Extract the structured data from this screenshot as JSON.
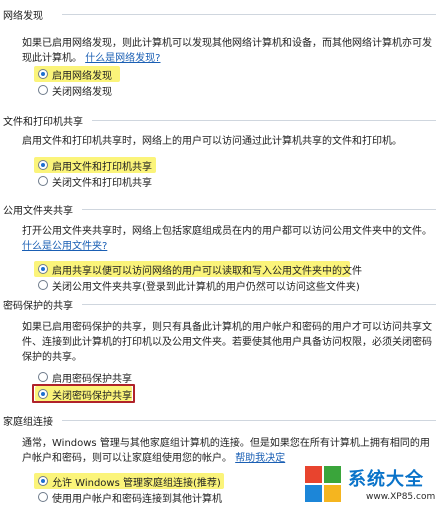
{
  "sections": [
    {
      "title": "网络发现",
      "desc": "如果已启用网络发现，则此计算机可以发现其他网络计算机和设备，而其他网络计算机亦可发现此计算机。",
      "link": "什么是网络发现?",
      "options": [
        {
          "label": "启用网络发现",
          "selected": true
        },
        {
          "label": "关闭网络发现",
          "selected": false
        }
      ]
    },
    {
      "title": "文件和打印机共享",
      "desc": "启用文件和打印机共享时，网络上的用户可以访问通过此计算机共享的文件和打印机。",
      "options": [
        {
          "label": "启用文件和打印机共享",
          "selected": true
        },
        {
          "label": "关闭文件和打印机共享",
          "selected": false
        }
      ]
    },
    {
      "title": "公用文件夹共享",
      "desc": "打开公用文件夹共享时，网络上包括家庭组成员在内的用户都可以访问公用文件夹中的文件。",
      "link_tail": "什么",
      "link_cont": "是公用文件夹?",
      "options": [
        {
          "label": "启用共享以便可以访问网络的用户可以读取和写入公用文件夹中的文件",
          "selected": true
        },
        {
          "label": "关闭公用文件夹共享(登录到此计算机的用户仍然可以访问这些文件夹)",
          "selected": false
        }
      ]
    },
    {
      "title": "密码保护的共享",
      "desc": "如果已启用密码保护的共享，则只有具备此计算机的用户帐户和密码的用户才可以访问共享文件、连接到此计算机的打印机以及公用文件夹。若要使其他用户具备访问权限，必须关闭密码保护的共享。",
      "options": [
        {
          "label": "启用密码保护共享",
          "selected": false
        },
        {
          "label": "关闭密码保护共享",
          "selected": true
        }
      ]
    },
    {
      "title": "家庭组连接",
      "desc": "通常，Windows 管理与其他家庭组计算机的连接。但是如果您在所有计算机上拥有相同的用户帐户和密码，则可以让家庭组使用您的帐户。",
      "link": "帮助我决定",
      "options": [
        {
          "label": "允许 Windows 管理家庭组连接(推荐)",
          "selected": true
        },
        {
          "label": "使用用户帐户和密码连接到其他计算机",
          "selected": false
        }
      ]
    }
  ],
  "watermark": {
    "title": "系统大全",
    "url": "www.XP85.com"
  },
  "colors": {
    "highlight": "#fbf47a",
    "red_box": "#b0232a",
    "link": "#1a5fb4",
    "rule": "#cfd6de"
  }
}
